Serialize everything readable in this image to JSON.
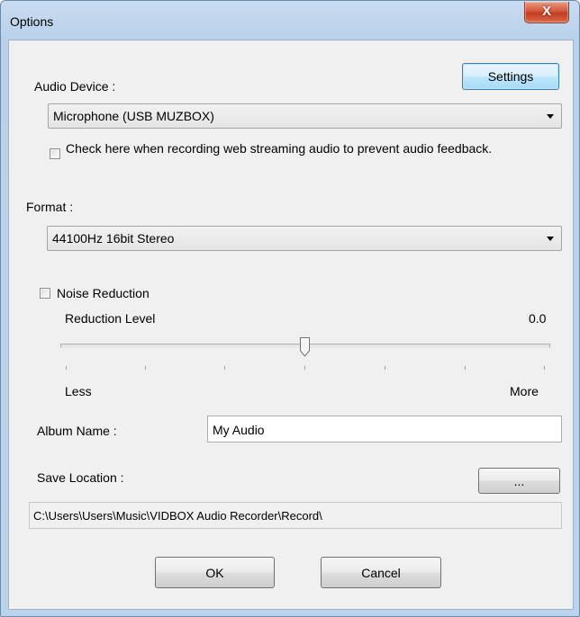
{
  "window": {
    "title": "Options",
    "close_label": "X"
  },
  "audio_device": {
    "label": "Audio Device :",
    "settings_label": "Settings",
    "selected": "Microphone (USB MUZBOX)",
    "feedback_checkbox_label": "Check here when recording web streaming audio to prevent audio feedback.",
    "feedback_checked": false
  },
  "format": {
    "label": "Format :",
    "selected": "44100Hz  16bit  Stereo"
  },
  "noise_reduction": {
    "label": "Noise Reduction",
    "checked": false,
    "level_label": "Reduction Level",
    "level_value": "0.0",
    "slider_position_fraction": 0.5,
    "min_label": "Less",
    "max_label": "More"
  },
  "album": {
    "label": "Album Name :",
    "value": "My Audio"
  },
  "save_location": {
    "label": "Save Location :",
    "browse_label": "...",
    "path": "C:\\Users\\Users\\Music\\VIDBOX Audio Recorder\\Record\\"
  },
  "footer": {
    "ok_label": "OK",
    "cancel_label": "Cancel"
  }
}
